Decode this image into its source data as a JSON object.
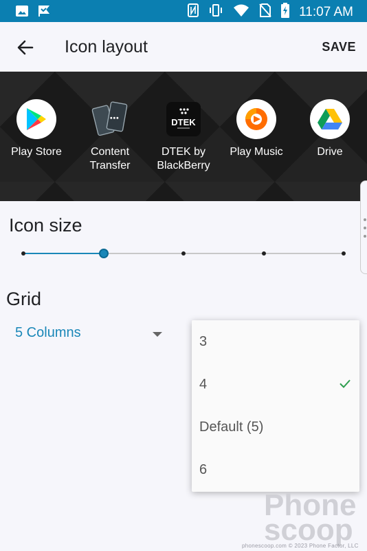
{
  "status_bar": {
    "time": "11:07 AM",
    "left_icons": [
      "image-icon",
      "flag-notification-icon"
    ],
    "right_icons": [
      "nfc-icon",
      "vibrate-icon",
      "wifi-icon",
      "no-sim-icon",
      "battery-charging-icon"
    ]
  },
  "header": {
    "title": "Icon layout",
    "save_label": "SAVE",
    "back_icon": "arrow-back-icon"
  },
  "preview": {
    "apps": [
      {
        "label": "Play Store",
        "icon": "play-store-icon"
      },
      {
        "label": "Content\nTransfer",
        "icon": "content-transfer-icon"
      },
      {
        "label": "DTEK by\nBlackBerry",
        "icon": "dtek-icon"
      },
      {
        "label": "Play Music",
        "icon": "play-music-icon"
      },
      {
        "label": "Drive",
        "icon": "drive-icon"
      }
    ]
  },
  "icon_size": {
    "label": "Icon size",
    "steps": 5,
    "selected_step_index": 1
  },
  "grid": {
    "label": "Grid",
    "selected_value": "5 Columns",
    "options": [
      {
        "label": "3",
        "checked": false
      },
      {
        "label": "4",
        "checked": true
      },
      {
        "label": "Default (5)",
        "checked": false
      },
      {
        "label": "6",
        "checked": false
      }
    ]
  },
  "watermark": {
    "line1": "Phone",
    "line2": "scoop",
    "site": "phonescoop.com",
    "copyright": "© 2023 Phone Factor, LLC"
  },
  "colors": {
    "status_bar": "#0b7fb1",
    "accent": "#1a87b8",
    "check": "#2e9e4f",
    "background": "#f6f6fb"
  }
}
